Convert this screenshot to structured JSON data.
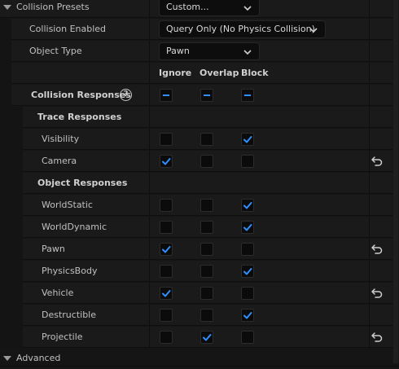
{
  "collision_presets": {
    "label": "Collision Presets",
    "value": "Custom..."
  },
  "collision_enabled": {
    "label": "Collision Enabled",
    "value": "Query Only (No Physics Collision)"
  },
  "object_type": {
    "label": "Object Type",
    "value": "Pawn"
  },
  "columns": {
    "ignore": "Ignore",
    "overlap": "Overlap",
    "block": "Block"
  },
  "collision_responses": {
    "label": "Collision Responses",
    "help_glyph": "?"
  },
  "trace_responses": {
    "label": "Trace Responses",
    "items": [
      {
        "label": "Visibility",
        "ignore": false,
        "overlap": false,
        "block": true,
        "reset": false
      },
      {
        "label": "Camera",
        "ignore": true,
        "overlap": false,
        "block": false,
        "reset": true
      }
    ]
  },
  "object_responses": {
    "label": "Object Responses",
    "items": [
      {
        "label": "WorldStatic",
        "ignore": false,
        "overlap": false,
        "block": true,
        "reset": false
      },
      {
        "label": "WorldDynamic",
        "ignore": false,
        "overlap": false,
        "block": true,
        "reset": false
      },
      {
        "label": "Pawn",
        "ignore": true,
        "overlap": false,
        "block": false,
        "reset": true
      },
      {
        "label": "PhysicsBody",
        "ignore": false,
        "overlap": false,
        "block": true,
        "reset": false
      },
      {
        "label": "Vehicle",
        "ignore": true,
        "overlap": false,
        "block": false,
        "reset": true
      },
      {
        "label": "Destructible",
        "ignore": false,
        "overlap": false,
        "block": true,
        "reset": false
      },
      {
        "label": "Projectile",
        "ignore": false,
        "overlap": true,
        "block": false,
        "reset": true
      }
    ]
  },
  "advanced": {
    "label": "Advanced"
  },
  "colors": {
    "accent": "#2f8fff",
    "background": "#151515",
    "row": "#1a1a1a"
  }
}
